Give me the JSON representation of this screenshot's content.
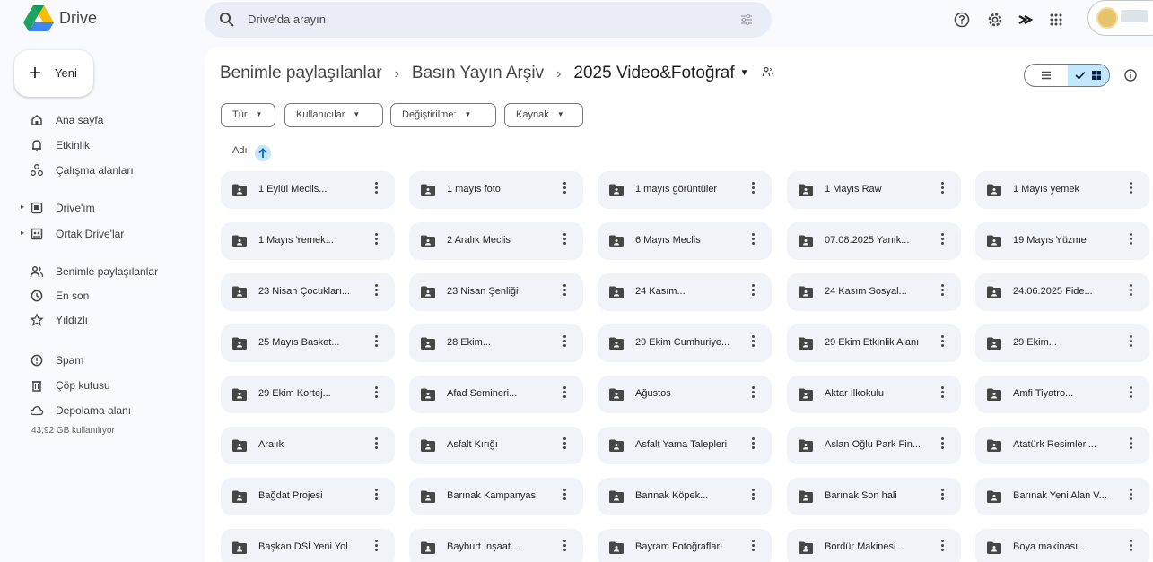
{
  "app": {
    "name": "Drive"
  },
  "search": {
    "placeholder": "Drive'da arayın",
    "icon": "search-icon",
    "filter_icon": "search-options-icon"
  },
  "top_icons": [
    "help-icon",
    "settings-icon",
    "gemini-icon",
    "apps-grid-icon"
  ],
  "sidebar": {
    "new_label": "Yeni",
    "items": [
      {
        "label": "Ana sayfa",
        "icon": "home-icon"
      },
      {
        "label": "Etkinlik",
        "icon": "bell-icon"
      },
      {
        "label": "Çalışma alanları",
        "icon": "workspaces-icon"
      },
      {
        "label": "Drive'ım",
        "icon": "my-drive-icon",
        "expandable": true
      },
      {
        "label": "Ortak Drive'lar",
        "icon": "shared-drives-icon",
        "expandable": true
      },
      {
        "label": "Benimle paylaşılanlar",
        "icon": "shared-with-me-icon"
      },
      {
        "label": "En son",
        "icon": "clock-icon"
      },
      {
        "label": "Yıldızlı",
        "icon": "star-icon"
      },
      {
        "label": "Spam",
        "icon": "spam-icon"
      },
      {
        "label": "Çöp kutusu",
        "icon": "trash-icon"
      },
      {
        "label": "Depolama alanı",
        "icon": "cloud-icon"
      }
    ],
    "storage_text": "43,92 GB kullanılıyor"
  },
  "breadcrumb": {
    "items": [
      "Benimle paylaşılanlar",
      "Basın Yayın Arşiv",
      "2025 Video&Fotoğraf"
    ]
  },
  "filters": [
    "Tür",
    "Kullanıcılar",
    "Değiştirilme:",
    "Kaynak"
  ],
  "sort": {
    "label": "Adı",
    "direction": "ascending"
  },
  "folders": [
    "1 Eylül Meclis...",
    "1 mayıs foto",
    "1 mayıs görüntüler",
    "1 Mayıs Raw",
    "1 Mayıs yemek",
    "1 Mayıs Yemek...",
    "2 Aralık Meclis",
    "6 Mayıs Meclis",
    "07.08.2025 Yanık...",
    "19 Mayıs Yüzme",
    "23 Nisan Çocukları...",
    "23 Nisan Şenliği",
    "24 Kasım...",
    "24 Kasım Sosyal...",
    "24.06.2025 Fide...",
    "25 Mayıs Basket...",
    "28 Ekim...",
    "29 Ekim Cumhuriye...",
    "29 Ekim Etkinlik Alanı",
    "29 Ekim...",
    "29 Ekim Kortej...",
    "Afad Semineri...",
    "Ağustos",
    "Aktar İlkokulu",
    "Amfi Tiyatro...",
    "Aralık",
    "Asfalt Kırığı",
    "Asfalt Yama Talepleri",
    "Aslan Oğlu Park Fin...",
    "Atatürk Resimleri...",
    "Bağdat Projesi",
    "Barınak Kampanyası",
    "Barınak Köpek...",
    "Barınak Son hali",
    "Barınak Yeni Alan V...",
    "Başkan DSİ Yeni Yol",
    "Bayburt İnşaat...",
    "Bayram Fotoğrafları",
    "Bordür Makinesi...",
    "Boya makinası..."
  ],
  "colors": {
    "background": "#f8fafd",
    "search_bg": "#e9eef6",
    "folder_bg": "#f0f4f9",
    "selected_toggle": "#c2e7ff"
  }
}
